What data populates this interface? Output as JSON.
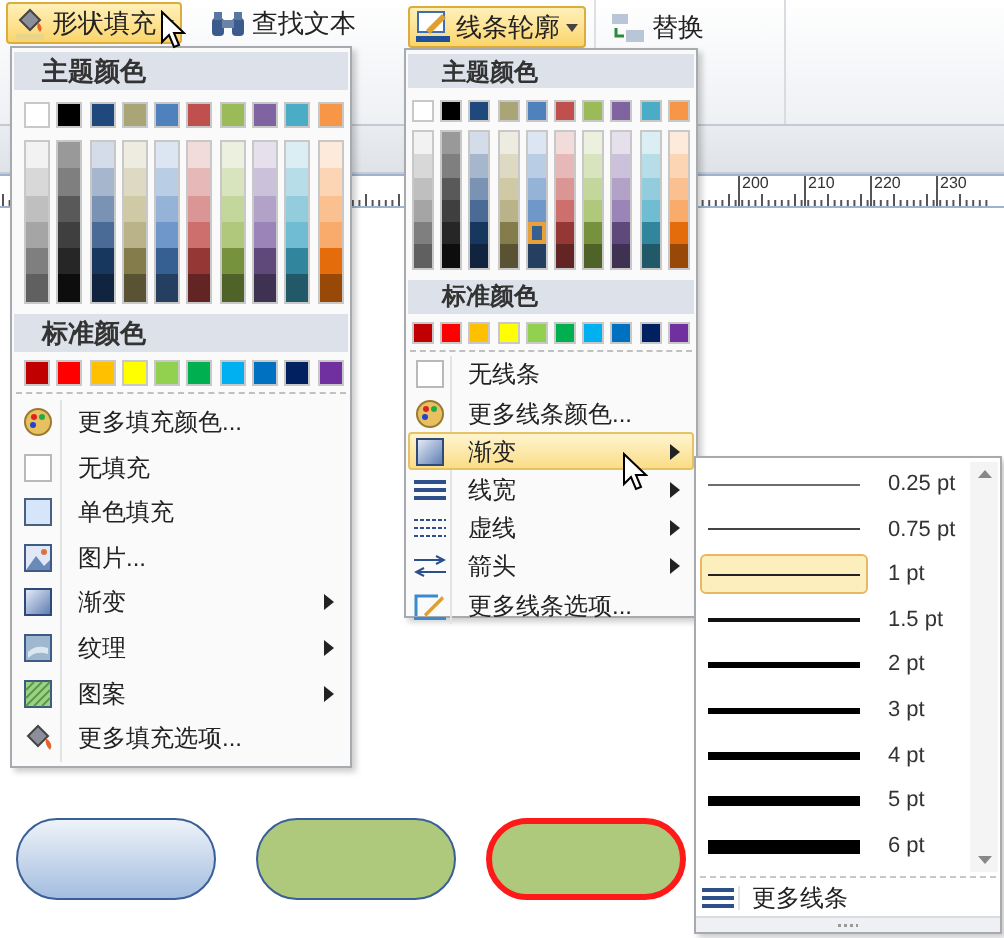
{
  "ribbon": {
    "buttons": [
      {
        "label": "形状填充",
        "kind": "fill",
        "pressed": true,
        "dropdown": true
      },
      {
        "label": "查找文本",
        "kind": "find",
        "pressed": false,
        "dropdown": false
      },
      {
        "label": "线条轮廓",
        "kind": "outline",
        "pressed": true,
        "dropdown": true
      },
      {
        "label": "替换",
        "kind": "replace",
        "pressed": false,
        "dropdown": false
      }
    ]
  },
  "ruler": {
    "labels": [
      "200",
      "210",
      "220",
      "230"
    ]
  },
  "fill_menu": {
    "theme_header": "主题颜色",
    "standard_header": "标准颜色",
    "theme_colors": [
      {
        "color": "#ffffff",
        "selected": false,
        "shades": [
          {
            "color": "#f2f2f2",
            "selected": false
          },
          {
            "color": "#d8d8d8",
            "selected": false
          },
          {
            "color": "#bfbfbf",
            "selected": false
          },
          {
            "color": "#a5a5a5",
            "selected": false
          },
          {
            "color": "#7f7f7f",
            "selected": false
          },
          {
            "color": "#606060",
            "selected": false
          }
        ]
      },
      {
        "color": "#000000",
        "selected": false,
        "shades": [
          {
            "color": "#999999",
            "selected": false
          },
          {
            "color": "#7f7f7f",
            "selected": false
          },
          {
            "color": "#595959",
            "selected": false
          },
          {
            "color": "#3f3f3f",
            "selected": false
          },
          {
            "color": "#262626",
            "selected": false
          },
          {
            "color": "#0d0d0d",
            "selected": false
          }
        ]
      },
      {
        "color": "#1f497d",
        "selected": false,
        "shades": [
          {
            "color": "#d3dce8",
            "selected": false
          },
          {
            "color": "#a6b7cd",
            "selected": false
          },
          {
            "color": "#7a93b5",
            "selected": false
          },
          {
            "color": "#4a6b96",
            "selected": false
          },
          {
            "color": "#17375e",
            "selected": false
          },
          {
            "color": "#10243f",
            "selected": false
          }
        ]
      },
      {
        "color": "#aaa577",
        "selected": false,
        "shades": [
          {
            "color": "#eeece1",
            "selected": false
          },
          {
            "color": "#ddd9c3",
            "selected": false
          },
          {
            "color": "#cfc9a6",
            "selected": false
          },
          {
            "color": "#bab38a",
            "selected": false
          },
          {
            "color": "#857c4b",
            "selected": false
          },
          {
            "color": "#5a5333",
            "selected": false
          }
        ]
      },
      {
        "color": "#4f81bd",
        "selected": false,
        "shades": [
          {
            "color": "#dce6f2",
            "selected": false
          },
          {
            "color": "#b9cde5",
            "selected": false
          },
          {
            "color": "#95b3d7",
            "selected": false
          },
          {
            "color": "#7097c9",
            "selected": false
          },
          {
            "color": "#376092",
            "selected": false
          },
          {
            "color": "#243f60",
            "selected": false
          }
        ]
      },
      {
        "color": "#c0504d",
        "selected": false,
        "shades": [
          {
            "color": "#f2dcdb",
            "selected": false
          },
          {
            "color": "#e6b9b8",
            "selected": false
          },
          {
            "color": "#d99694",
            "selected": false
          },
          {
            "color": "#cc6f6d",
            "selected": false
          },
          {
            "color": "#953735",
            "selected": false
          },
          {
            "color": "#632523",
            "selected": false
          }
        ]
      },
      {
        "color": "#9bbb59",
        "selected": false,
        "shades": [
          {
            "color": "#ebf1de",
            "selected": false
          },
          {
            "color": "#d7e4bd",
            "selected": false
          },
          {
            "color": "#c3d69b",
            "selected": false
          },
          {
            "color": "#afc87c",
            "selected": false
          },
          {
            "color": "#76923c",
            "selected": false
          },
          {
            "color": "#4f6228",
            "selected": false
          }
        ]
      },
      {
        "color": "#8064a2",
        "selected": false,
        "shades": [
          {
            "color": "#e6e0ec",
            "selected": false
          },
          {
            "color": "#ccc1da",
            "selected": false
          },
          {
            "color": "#b3a2c7",
            "selected": false
          },
          {
            "color": "#9a84b8",
            "selected": false
          },
          {
            "color": "#5f497a",
            "selected": false
          },
          {
            "color": "#3f3151",
            "selected": false
          }
        ]
      },
      {
        "color": "#4bacc6",
        "selected": false,
        "shades": [
          {
            "color": "#dbeef4",
            "selected": false
          },
          {
            "color": "#b7dee8",
            "selected": false
          },
          {
            "color": "#93cddd",
            "selected": false
          },
          {
            "color": "#70bcd2",
            "selected": false
          },
          {
            "color": "#31859c",
            "selected": false
          },
          {
            "color": "#215968",
            "selected": false
          }
        ]
      },
      {
        "color": "#f79646",
        "selected": false,
        "shades": [
          {
            "color": "#fdeada",
            "selected": false
          },
          {
            "color": "#fcd5b5",
            "selected": false
          },
          {
            "color": "#fac090",
            "selected": false
          },
          {
            "color": "#f9ab6c",
            "selected": false
          },
          {
            "color": "#e46c0a",
            "selected": false
          },
          {
            "color": "#984807",
            "selected": false
          }
        ]
      }
    ],
    "standard_colors": [
      {
        "color": "#c00000",
        "selected": false
      },
      {
        "color": "#ff0000",
        "selected": false
      },
      {
        "color": "#ffc000",
        "selected": false
      },
      {
        "color": "#ffff00",
        "selected": false
      },
      {
        "color": "#92d050",
        "selected": false
      },
      {
        "color": "#00b050",
        "selected": false
      },
      {
        "color": "#00b0f0",
        "selected": false
      },
      {
        "color": "#0070c0",
        "selected": false
      },
      {
        "color": "#002060",
        "selected": false
      },
      {
        "color": "#7030a0",
        "selected": false
      }
    ],
    "items": [
      {
        "label": "更多填充颜色...",
        "kind": "palette",
        "selected": false,
        "submenu": false
      },
      {
        "label": "无填充",
        "kind": "none",
        "selected": false,
        "submenu": false
      },
      {
        "label": "单色填充",
        "kind": "solid",
        "selected": false,
        "submenu": false
      },
      {
        "label": "图片...",
        "kind": "picture",
        "selected": false,
        "submenu": false
      },
      {
        "label": "渐变",
        "kind": "gradient",
        "selected": false,
        "submenu": true
      },
      {
        "label": "纹理",
        "kind": "texture",
        "selected": false,
        "submenu": true
      },
      {
        "label": "图案",
        "kind": "pattern",
        "selected": false,
        "submenu": true
      },
      {
        "label": "更多填充选项...",
        "kind": "bucket",
        "selected": false,
        "submenu": false
      }
    ]
  },
  "line_menu": {
    "theme_header": "主题颜色",
    "standard_header": "标准颜色",
    "theme_colors": [
      {
        "color": "#ffffff",
        "selected": false,
        "shades": [
          {
            "color": "#f2f2f2",
            "selected": false
          },
          {
            "color": "#d8d8d8",
            "selected": false
          },
          {
            "color": "#bfbfbf",
            "selected": false
          },
          {
            "color": "#a5a5a5",
            "selected": false
          },
          {
            "color": "#7f7f7f",
            "selected": false
          },
          {
            "color": "#606060",
            "selected": false
          }
        ]
      },
      {
        "color": "#000000",
        "selected": false,
        "shades": [
          {
            "color": "#999999",
            "selected": false
          },
          {
            "color": "#7f7f7f",
            "selected": false
          },
          {
            "color": "#595959",
            "selected": false
          },
          {
            "color": "#3f3f3f",
            "selected": false
          },
          {
            "color": "#262626",
            "selected": false
          },
          {
            "color": "#0d0d0d",
            "selected": false
          }
        ]
      },
      {
        "color": "#1f497d",
        "selected": false,
        "shades": [
          {
            "color": "#d3dce8",
            "selected": false
          },
          {
            "color": "#a6b7cd",
            "selected": false
          },
          {
            "color": "#7a93b5",
            "selected": false
          },
          {
            "color": "#4a6b96",
            "selected": false
          },
          {
            "color": "#17375e",
            "selected": false
          },
          {
            "color": "#10243f",
            "selected": false
          }
        ]
      },
      {
        "color": "#aaa577",
        "selected": false,
        "shades": [
          {
            "color": "#eeece1",
            "selected": false
          },
          {
            "color": "#ddd9c3",
            "selected": false
          },
          {
            "color": "#cfc9a6",
            "selected": false
          },
          {
            "color": "#bab38a",
            "selected": false
          },
          {
            "color": "#857c4b",
            "selected": false
          },
          {
            "color": "#5a5333",
            "selected": false
          }
        ]
      },
      {
        "color": "#4f81bd",
        "selected": false,
        "shades": [
          {
            "color": "#dce6f2",
            "selected": false
          },
          {
            "color": "#b9cde5",
            "selected": false
          },
          {
            "color": "#95b3d7",
            "selected": false
          },
          {
            "color": "#7097c9",
            "selected": false
          },
          {
            "color": "#376092",
            "selected": true
          },
          {
            "color": "#243f60",
            "selected": false
          }
        ]
      },
      {
        "color": "#c0504d",
        "selected": false,
        "shades": [
          {
            "color": "#f2dcdb",
            "selected": false
          },
          {
            "color": "#e6b9b8",
            "selected": false
          },
          {
            "color": "#d99694",
            "selected": false
          },
          {
            "color": "#cc6f6d",
            "selected": false
          },
          {
            "color": "#953735",
            "selected": false
          },
          {
            "color": "#632523",
            "selected": false
          }
        ]
      },
      {
        "color": "#9bbb59",
        "selected": false,
        "shades": [
          {
            "color": "#ebf1de",
            "selected": false
          },
          {
            "color": "#d7e4bd",
            "selected": false
          },
          {
            "color": "#c3d69b",
            "selected": false
          },
          {
            "color": "#afc87c",
            "selected": false
          },
          {
            "color": "#76923c",
            "selected": false
          },
          {
            "color": "#4f6228",
            "selected": false
          }
        ]
      },
      {
        "color": "#8064a2",
        "selected": false,
        "shades": [
          {
            "color": "#e6e0ec",
            "selected": false
          },
          {
            "color": "#ccc1da",
            "selected": false
          },
          {
            "color": "#b3a2c7",
            "selected": false
          },
          {
            "color": "#9a84b8",
            "selected": false
          },
          {
            "color": "#5f497a",
            "selected": false
          },
          {
            "color": "#3f3151",
            "selected": false
          }
        ]
      },
      {
        "color": "#4bacc6",
        "selected": false,
        "shades": [
          {
            "color": "#dbeef4",
            "selected": false
          },
          {
            "color": "#b7dee8",
            "selected": false
          },
          {
            "color": "#93cddd",
            "selected": false
          },
          {
            "color": "#70bcd2",
            "selected": false
          },
          {
            "color": "#31859c",
            "selected": false
          },
          {
            "color": "#215968",
            "selected": false
          }
        ]
      },
      {
        "color": "#f79646",
        "selected": false,
        "shades": [
          {
            "color": "#fdeada",
            "selected": false
          },
          {
            "color": "#fcd5b5",
            "selected": false
          },
          {
            "color": "#fac090",
            "selected": false
          },
          {
            "color": "#f9ab6c",
            "selected": false
          },
          {
            "color": "#e46c0a",
            "selected": false
          },
          {
            "color": "#984807",
            "selected": false
          }
        ]
      }
    ],
    "standard_colors": [
      {
        "color": "#c00000",
        "selected": false
      },
      {
        "color": "#ff0000",
        "selected": false
      },
      {
        "color": "#ffc000",
        "selected": false
      },
      {
        "color": "#ffff00",
        "selected": false
      },
      {
        "color": "#92d050",
        "selected": false
      },
      {
        "color": "#00b050",
        "selected": false
      },
      {
        "color": "#00b0f0",
        "selected": false
      },
      {
        "color": "#0070c0",
        "selected": false
      },
      {
        "color": "#002060",
        "selected": false
      },
      {
        "color": "#7030a0",
        "selected": false
      }
    ],
    "items": [
      {
        "label": "无线条",
        "kind": "none",
        "selected": false,
        "submenu": false
      },
      {
        "label": "更多线条颜色...",
        "kind": "palette",
        "selected": false,
        "submenu": false
      },
      {
        "label": "渐变",
        "kind": "gradient",
        "selected": true,
        "submenu": true
      },
      {
        "label": "线宽",
        "kind": "weight",
        "selected": false,
        "submenu": true
      },
      {
        "label": "虚线",
        "kind": "dash",
        "selected": false,
        "submenu": true
      },
      {
        "label": "箭头",
        "kind": "arrows",
        "selected": false,
        "submenu": true
      },
      {
        "label": "更多线条选项...",
        "kind": "options",
        "selected": false,
        "submenu": false
      }
    ]
  },
  "weight_menu": {
    "options": [
      {
        "label": "0.25 pt",
        "selected": false
      },
      {
        "label": "0.75 pt",
        "selected": false
      },
      {
        "label": "1 pt",
        "selected": true
      },
      {
        "label": "1.5 pt",
        "selected": false
      },
      {
        "label": "2 pt",
        "selected": false
      },
      {
        "label": "3 pt",
        "selected": false
      },
      {
        "label": "4 pt",
        "selected": false
      },
      {
        "label": "5 pt",
        "selected": false
      },
      {
        "label": "6 pt",
        "selected": false
      }
    ],
    "footer": "更多线条"
  },
  "shapes": [
    {
      "kind": "gradient",
      "color": "#a4bddf"
    },
    {
      "kind": "solid",
      "color": "#afc97c"
    },
    {
      "kind": "red-outline",
      "color": "#afc97c"
    }
  ]
}
